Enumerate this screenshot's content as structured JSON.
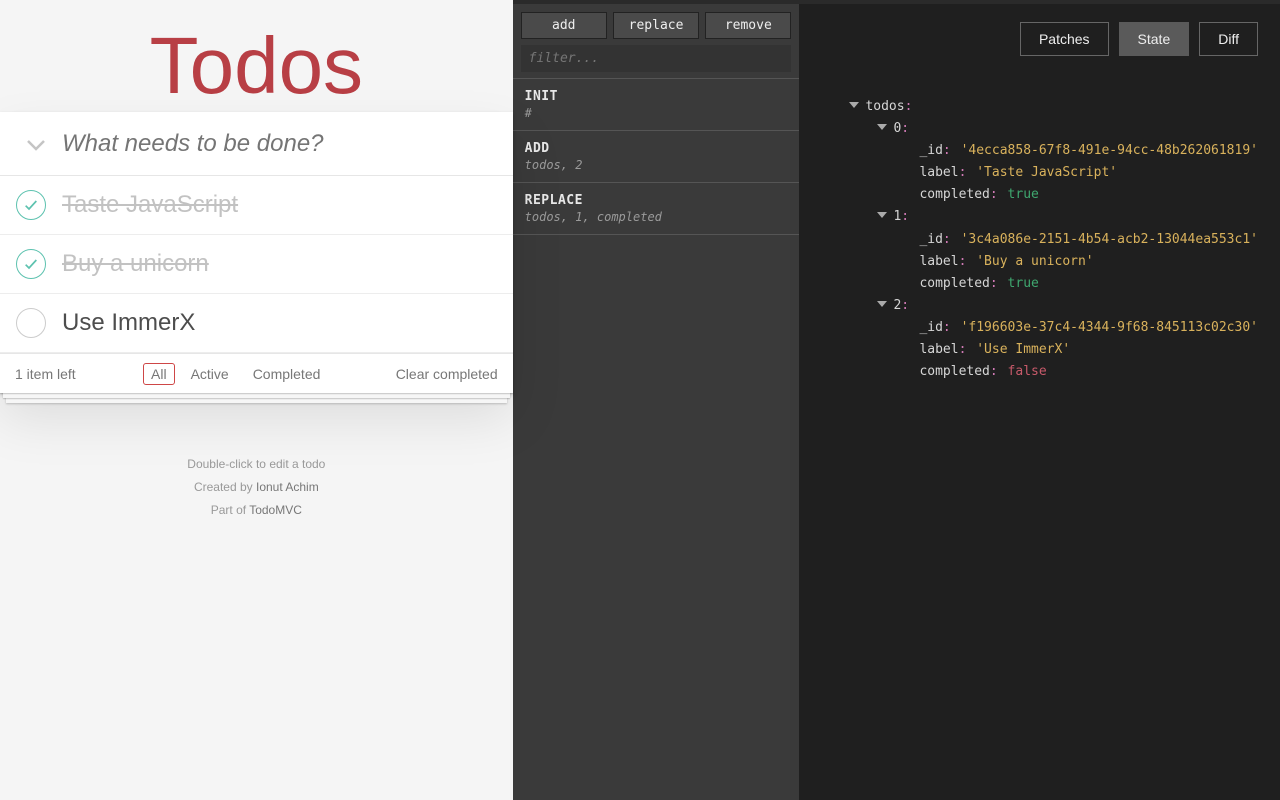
{
  "todo": {
    "title": "Todos",
    "placeholder": "What needs to be done?",
    "items": [
      {
        "label": "Taste JavaScript",
        "completed": true
      },
      {
        "label": "Buy a unicorn",
        "completed": true
      },
      {
        "label": "Use ImmerX",
        "completed": false
      }
    ],
    "items_left": "1 item left",
    "filters": {
      "all": "All",
      "active": "Active",
      "completed": "Completed",
      "selected": "all"
    },
    "clear_completed": "Clear completed",
    "info": {
      "line1": "Double-click to edit a todo",
      "line2_prefix": "Created by ",
      "line2_author": "Ionut Achim",
      "line3_prefix": "Part of ",
      "line3_link": "TodoMVC"
    }
  },
  "actions": {
    "buttons": {
      "add": "add",
      "replace": "replace",
      "remove": "remove"
    },
    "filter_placeholder": "filter...",
    "log": [
      {
        "op": "INIT",
        "path": "#"
      },
      {
        "op": "ADD",
        "path": "todos, 2"
      },
      {
        "op": "REPLACE",
        "path": "todos, 1, completed"
      }
    ]
  },
  "inspector": {
    "tabs": {
      "patches": "Patches",
      "state": "State",
      "diff": "Diff",
      "active": "state"
    },
    "state": {
      "root_key": "todos",
      "items": [
        {
          "_id": "4ecca858-67f8-491e-94cc-48b262061819",
          "label": "Taste JavaScript",
          "completed": true
        },
        {
          "_id": "3c4a086e-2151-4b54-acb2-13044ea553c1",
          "label": "Buy a unicorn",
          "completed": true
        },
        {
          "_id": "f196603e-37c4-4344-9f68-845113c02c30",
          "label": "Use ImmerX",
          "completed": false
        }
      ],
      "field_names": {
        "id": "_id",
        "label": "label",
        "completed": "completed"
      }
    }
  }
}
